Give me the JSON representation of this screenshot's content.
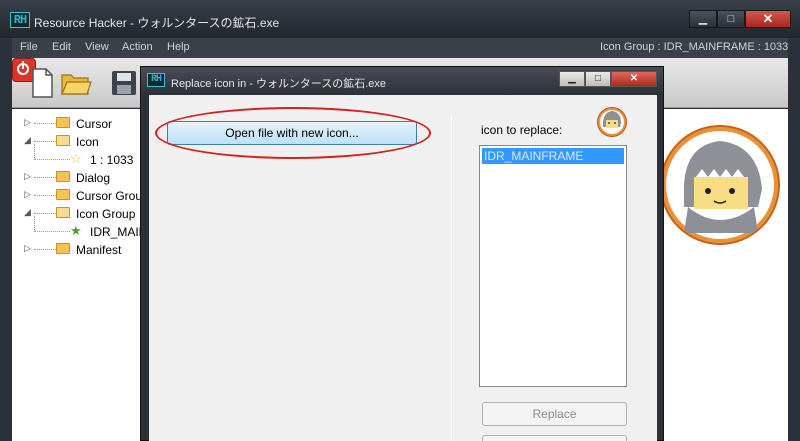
{
  "main_window": {
    "logo_text": "RH",
    "title": "Resource Hacker - ウォルンタースの鉱石.exe",
    "min_glyph": "▁",
    "max_glyph": "□",
    "close_glyph": "✕",
    "menu": [
      {
        "label": "File"
      },
      {
        "label": "Edit"
      },
      {
        "label": "View"
      },
      {
        "label": "Action"
      },
      {
        "label": "Help"
      }
    ],
    "status": "Icon Group : IDR_MAINFRAME : 1033"
  },
  "toolbar": {
    "icons": [
      "new-file-icon",
      "open-folder-icon",
      "save-icon",
      "stop-icon"
    ]
  },
  "tree": {
    "items": [
      {
        "label": "Cursor",
        "expanded": false
      },
      {
        "label": "Icon",
        "expanded": true
      },
      {
        "label": "1 : 1033"
      },
      {
        "label": "Dialog",
        "expanded": false
      },
      {
        "label": "Cursor Group",
        "expanded": false
      },
      {
        "label": "Icon Group",
        "expanded": true
      },
      {
        "label": "IDR_MAIN"
      },
      {
        "label": "Manifest",
        "expanded": false
      }
    ]
  },
  "dialog": {
    "logo_text": "RH",
    "title": "Replace icon in - ウォルンタースの鉱石.exe",
    "open_button": "Open file with new icon...",
    "icon_to_replace_label": "icon to replace:",
    "list_items": [
      "IDR_MAINFRAME"
    ],
    "replace_button": "Replace"
  },
  "colors": {
    "highlight_ellipse": "#d81e1e",
    "selection": "#3399ff",
    "stop_button": "#d9352a"
  }
}
